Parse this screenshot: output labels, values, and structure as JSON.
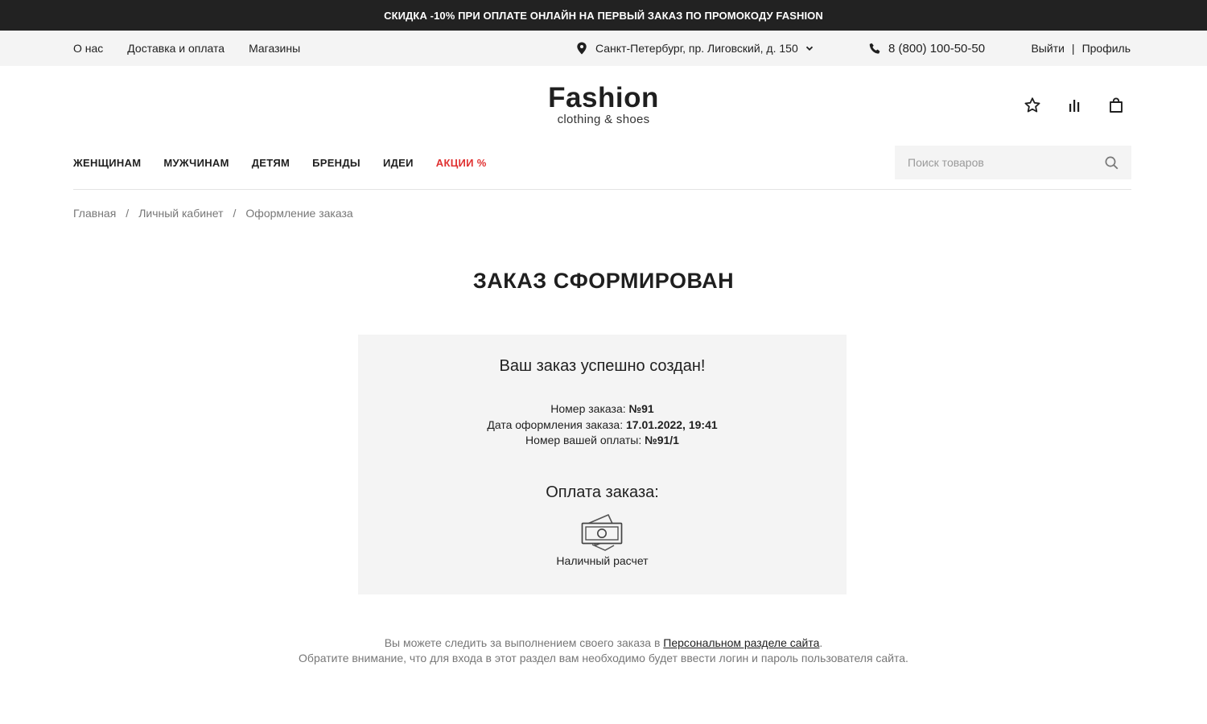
{
  "promo": {
    "text": "СКИДКА -10% ПРИ ОПЛАТЕ ОНЛАЙН НА ПЕРВЫЙ ЗАКАЗ ПО ПРОМОКОДУ FASHION"
  },
  "topbar": {
    "links": [
      {
        "label": "О нас"
      },
      {
        "label": "Доставка и оплата"
      },
      {
        "label": "Магазины"
      }
    ],
    "address": "Санкт-Петербург, пр. Лиговский, д. 150",
    "phone": "8 (800) 100-50-50",
    "logout": "Выйти",
    "separator": "|",
    "profile": "Профиль"
  },
  "logo": {
    "name": "Fashion",
    "tagline": "clothing & shoes"
  },
  "header_icons": [
    "star-icon",
    "compare-icon",
    "bag-icon"
  ],
  "nav": {
    "items": [
      {
        "label": "ЖЕНЩИНАМ"
      },
      {
        "label": "МУЖЧИНАМ"
      },
      {
        "label": "ДЕТЯМ"
      },
      {
        "label": "БРЕНДЫ"
      },
      {
        "label": "ИДЕИ"
      },
      {
        "label": "АКЦИИ %"
      }
    ],
    "sale_color": "#e03131"
  },
  "search": {
    "placeholder": "Поиск товаров"
  },
  "breadcrumb": {
    "items": [
      "Главная",
      "Личный кабинет",
      "Оформление заказа"
    ],
    "separator": "/"
  },
  "page": {
    "title": "ЗАКАЗ СФОРМИРОВАН"
  },
  "order": {
    "success": "Ваш заказ успешно создан!",
    "number_label": "Номер заказа:",
    "number_value": "№91",
    "date_label": "Дата оформления заказа:",
    "date_value": "17.01.2022, 19:41",
    "payment_no_label": "Номер вашей оплаты:",
    "payment_no_value": "№91/1",
    "payment_title": "Оплата заказа:",
    "payment_method": "Наличный расчет",
    "payment_icon": "cash-icon"
  },
  "footer": {
    "line1_before": "Вы можете следить за выполнением своего заказа в",
    "line1_link": "Персональном разделе сайта",
    "line1_after": ".",
    "line2": "Обратите внимание, что для входа в этот раздел вам необходимо будет ввести логин и пароль пользователя сайта."
  }
}
